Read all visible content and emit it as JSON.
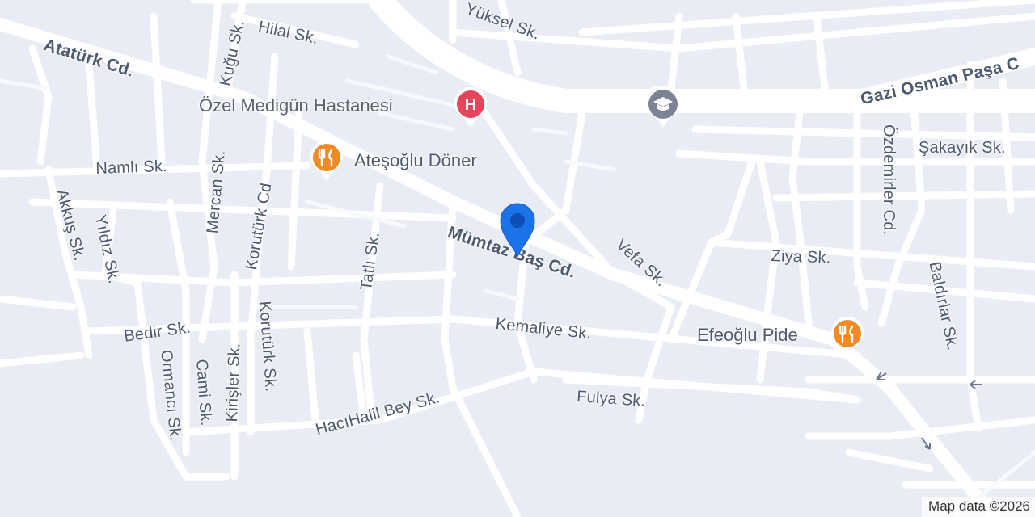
{
  "map": {
    "streets": {
      "ataturk": "Atatürk Cd.",
      "hilal": "Hilal Sk.",
      "kugu": "Kuğu Sk.",
      "yuksel": "Yüksel Sk.",
      "gazi_osman_pasa": "Gazi Osman Paşa C",
      "namli": "Namlı Sk.",
      "mercan": "Mercan Sk.",
      "koruturk_cd": "Korutürk Cd",
      "tatli": "Tatlı Sk.",
      "mumtaz_bas": "Mümtaz Baş Cd.",
      "vefa": "Vefa Sk.",
      "ziya": "Ziya Sk.",
      "ozdemirler": "Özdemirler Cd.",
      "sakayik": "Şakayık Sk.",
      "baldirlar": "Baldırlar Sk.",
      "akkus": "Akkuş Sk.",
      "yildiz": "Yıldız Sk.",
      "bedir": "Bedir Sk.",
      "ormanci": "Ormancı Sk.",
      "cami": "Cami Sk.",
      "kirisler": "Kirişler Sk.",
      "koruturk_sk": "Korutürk Sk.",
      "kemaliye": "Kemaliye Sk.",
      "fulya": "Fulya Sk.",
      "hacihalil_bey": "HacıHalil Bey Sk."
    },
    "pois": {
      "hospital": {
        "name": "Özel Medigün Hastanesi",
        "icon": "hospital-icon",
        "color": "#e8445a"
      },
      "doner": {
        "name": "Ateşoğlu Döner",
        "icon": "restaurant-icon",
        "color": "#f08a24"
      },
      "pide": {
        "name": "Efeoğlu Pide",
        "icon": "restaurant-icon",
        "color": "#f08a24"
      },
      "school": {
        "name": "",
        "icon": "school-icon",
        "color": "#7b8394"
      }
    },
    "location_pin": {
      "icon": "location-pin-icon",
      "color": "#1a73e8"
    },
    "attribution": "Map data ©2026"
  }
}
